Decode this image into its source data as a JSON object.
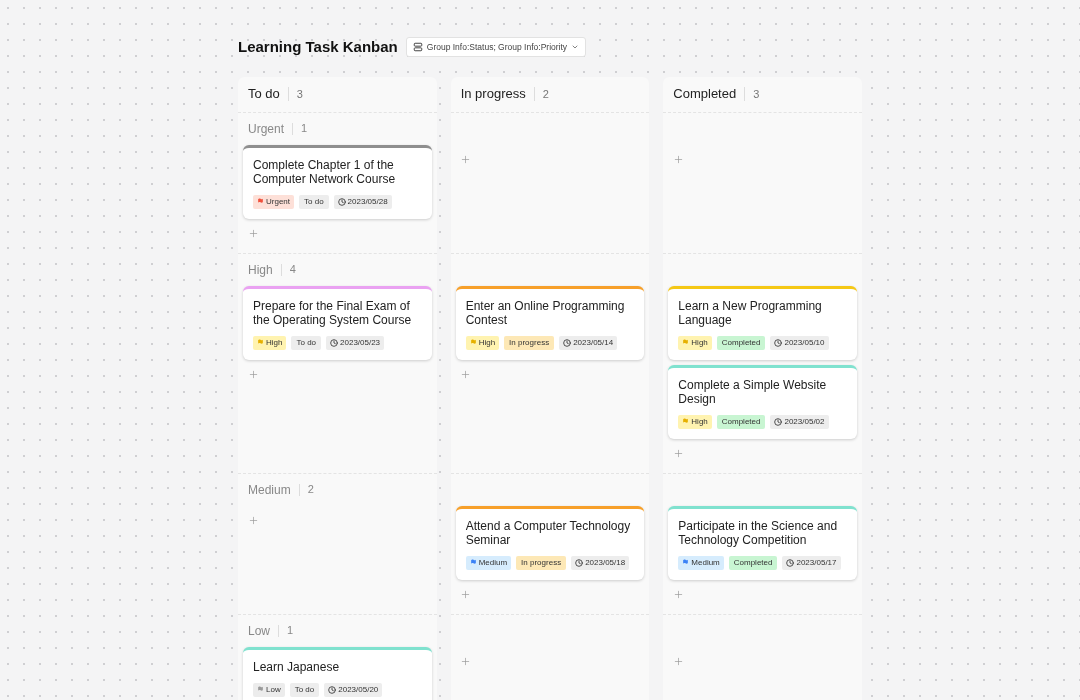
{
  "title": "Learning Task Kanban",
  "group_button": {
    "label": "Group Info:Status; Group Info:Priority"
  },
  "columns": [
    {
      "title": "To do",
      "count": "3"
    },
    {
      "title": "In progress",
      "count": "2"
    },
    {
      "title": "Completed",
      "count": "3"
    }
  ],
  "lanes": [
    {
      "label": "Urgent",
      "count": "1",
      "cells": [
        [
          {
            "title": "Complete Chapter 1 of the Computer Network Course",
            "color": "#8f8f8f",
            "priority": {
              "label": "Urgent",
              "kind": "urgent"
            },
            "status": {
              "label": "To do",
              "kind": "todo"
            },
            "date": "2023/05/28"
          }
        ],
        [],
        []
      ]
    },
    {
      "label": "High",
      "count": "4",
      "cells": [
        [
          {
            "title": "Prepare for the Final Exam of the Operating System Course",
            "color": "#eaa2f2",
            "priority": {
              "label": "High",
              "kind": "high"
            },
            "status": {
              "label": "To do",
              "kind": "todo"
            },
            "date": "2023/05/23"
          }
        ],
        [
          {
            "title": "Enter an Online Programming Contest",
            "color": "#f7a02a",
            "priority": {
              "label": "High",
              "kind": "high"
            },
            "status": {
              "label": "In progress",
              "kind": "in_progress"
            },
            "date": "2023/05/14"
          }
        ],
        [
          {
            "title": "Learn a New Programming Language",
            "color": "#f5c816",
            "priority": {
              "label": "High",
              "kind": "high"
            },
            "status": {
              "label": "Completed",
              "kind": "completed"
            },
            "date": "2023/05/10"
          },
          {
            "title": "Complete a Simple Website Design",
            "color": "#80e2cf",
            "priority": {
              "label": "High",
              "kind": "high"
            },
            "status": {
              "label": "Completed",
              "kind": "completed"
            },
            "date": "2023/05/02"
          }
        ]
      ]
    },
    {
      "label": "Medium",
      "count": "2",
      "cells": [
        [],
        [
          {
            "title": "Attend a Computer Technology Seminar",
            "color": "#f7a02a",
            "priority": {
              "label": "Medium",
              "kind": "medium"
            },
            "status": {
              "label": "In progress",
              "kind": "in_progress"
            },
            "date": "2023/05/18"
          }
        ],
        [
          {
            "title": "Participate in the Science and Technology Competition",
            "color": "#80e2cf",
            "priority": {
              "label": "Medium",
              "kind": "medium"
            },
            "status": {
              "label": "Completed",
              "kind": "completed"
            },
            "date": "2023/05/17"
          }
        ]
      ]
    },
    {
      "label": "Low",
      "count": "1",
      "cells": [
        [
          {
            "title": "Learn Japanese",
            "color": "#80e2cf",
            "priority": {
              "label": "Low",
              "kind": "low"
            },
            "status": {
              "label": "To do",
              "kind": "todo"
            },
            "date": "2023/05/20"
          }
        ],
        [],
        []
      ]
    }
  ]
}
